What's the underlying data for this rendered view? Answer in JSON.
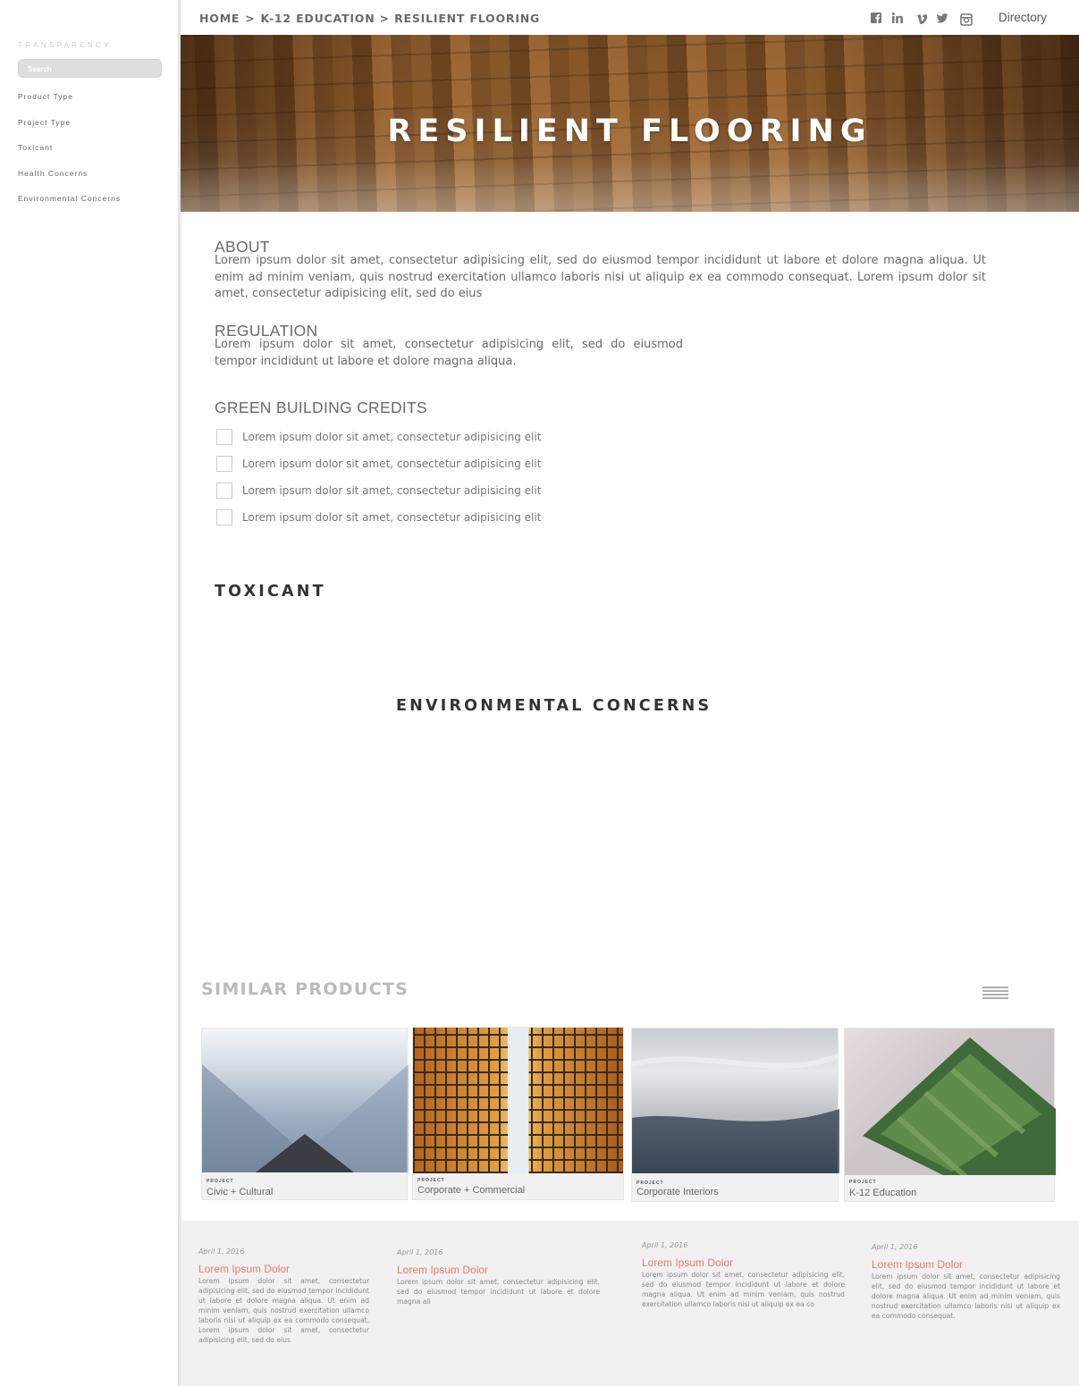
{
  "sidebar": {
    "brand": "TRANSPARENCY",
    "search_placeholder": "Search",
    "items": [
      {
        "label": "Product Type"
      },
      {
        "label": "Project Type"
      },
      {
        "label": "Toxicant"
      },
      {
        "label": "Health Concerns"
      },
      {
        "label": "Environmental Concerns"
      }
    ]
  },
  "header": {
    "breadcrumb": {
      "home": "HOME",
      "sep": ">",
      "k12": "K-12 EDUCATION",
      "current": "> RESILIENT FLOORING"
    },
    "social": [
      "facebook-icon",
      "linkedin-icon",
      "vimeo-icon",
      "twitter-icon",
      "instagram-icon"
    ],
    "directory": "Directory"
  },
  "hero": {
    "title": "RESILIENT FLOORING"
  },
  "about": {
    "heading": "ABOUT",
    "body": "Lorem ipsum dolor sit amet, consectetur adipisicing elit, sed do eiusmod tempor incididunt ut labore et dolore magna aliqua. Ut enim ad minim veniam, quis nostrud exercitation ullamco laboris nisi ut aliquip ex ea commodo consequat. Lorem ipsum dolor sit amet, consectetur adipisicing elit, sed do eius"
  },
  "regulation": {
    "heading": "REGULATION",
    "body": "Lorem ipsum dolor sit amet, consectetur adipisicing elit, sed do eiusmod tempor incididunt ut labore et dolore magna aliqua."
  },
  "green": {
    "heading": "GREEN BUILDING CREDITS",
    "credits": [
      "Lorem ipsum dolor sit amet, consectetur adipisicing elit",
      "Lorem ipsum dolor sit amet, consectetur adipisicing elit",
      "Lorem ipsum dolor sit amet, consectetur adipisicing elit",
      "Lorem ipsum dolor sit amet, consectetur adipisicing elit"
    ]
  },
  "toxicant": {
    "heading": "TOXICANT"
  },
  "environmental": {
    "heading": "ENVIRONMENTAL CONCERNS"
  },
  "similar": {
    "heading": "SIMILAR PRODUCTS",
    "cards": [
      {
        "project_label": "PROJECT",
        "category": "Civic + Cultural"
      },
      {
        "project_label": "PROJECT",
        "category": "Corporate + Commercial"
      },
      {
        "project_label": "PROJECT",
        "category": "Corporate Interiors"
      },
      {
        "project_label": "PROJECT",
        "category": "K-12 Education"
      }
    ]
  },
  "footer": {
    "posts": [
      {
        "date": "April 1, 2016",
        "title": "Lorem Ipsum Dolor",
        "body": "Lorem ipsum dolor sit amet, consectetur adipisicing elit, sed do eiusmod tempor incididunt ut labore et dolore magna aliqua. Ut enim ad minim veniam, quis nostrud exercitation ullamco laboris nisi ut aliquip ex ea commodo consequat. Lorem ipsum dolor sit amet, consectetur adipisicing elit, sed do eius"
      },
      {
        "date": "April 1, 2016",
        "title": "Lorem Ipsum Dolor",
        "body": "Lorem ipsum dolor sit amet, consectetur adipisicing elit, sed do eiusmod tempor incididunt ut labore et dolore magna ali"
      },
      {
        "date": "April 1, 2016",
        "title": "Lorem Ipsum Dolor",
        "body": "Lorem ipsum dolor sit amet, consectetur adipisicing elit, sed do eiusmod tempor incididunt ut labore et dolore magna aliqua. Ut enim ad minim veniam, quis nostrud exercitation ullamco laboris nisi ut aliquip ex ea co"
      },
      {
        "date": "April 1, 2016",
        "title": "Lorem Ipsum Dolor",
        "body": "Lorem ipsum dolor sit amet, consectetur adipisicing elit, sed do eiusmod tempor incididunt ut labore et dolore magna aliqua. Ut enim ad minim veniam, quis nostrud exercitation ullamco laboris nisi ut aliquip ex ea commodo consequat."
      }
    ]
  },
  "colors": {
    "accent": "#f07a6a",
    "footer_bg": "#f1f1f1"
  }
}
